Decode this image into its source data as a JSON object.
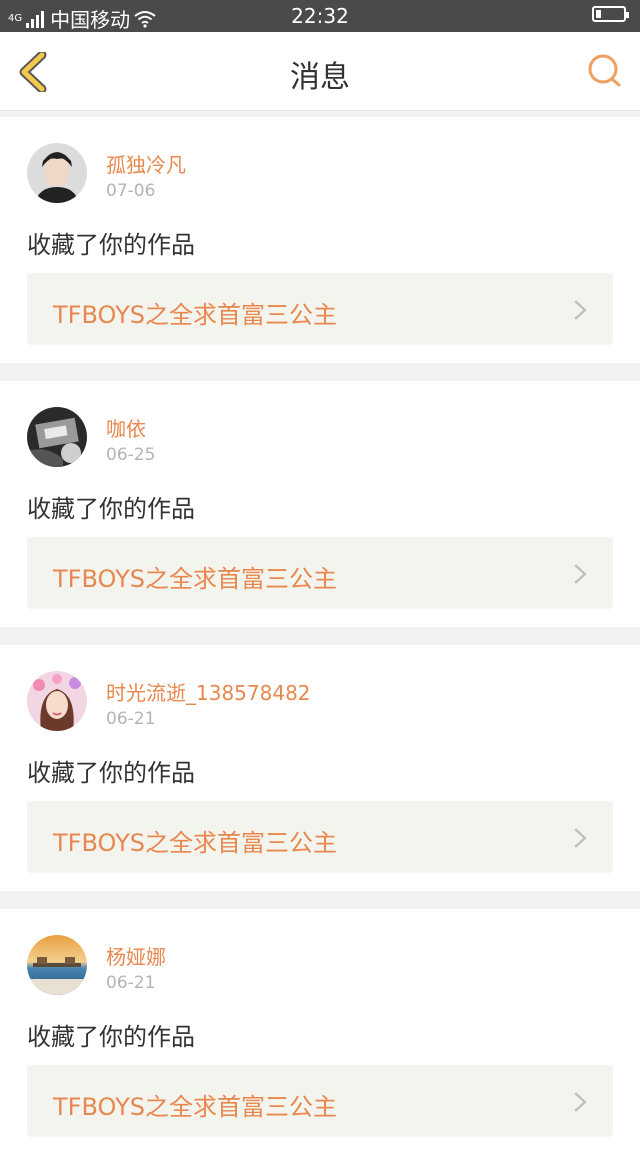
{
  "status_bar": {
    "network": "4G",
    "carrier": "中国移动",
    "time": "22:32"
  },
  "header": {
    "title": "消息",
    "back_icon": "chevron-left-icon",
    "search_icon": "search-icon"
  },
  "colors": {
    "accent": "#e8874e",
    "back_arrow": "#f2c94c",
    "status_bar_bg": "#4a4a4a",
    "work_box_bg": "#f4f4ef"
  },
  "messages": [
    {
      "username": "孤独冷凡",
      "date": "07-06",
      "action": "收藏了你的作品",
      "work_title": "TFBOYS之全求首富三公主"
    },
    {
      "username": "咖依",
      "date": "06-25",
      "action": "收藏了你的作品",
      "work_title": "TFBOYS之全求首富三公主"
    },
    {
      "username": "时光流逝_138578482",
      "date": "06-21",
      "action": "收藏了你的作品",
      "work_title": "TFBOYS之全求首富三公主"
    },
    {
      "username": "杨娅娜",
      "date": "06-21",
      "action": "收藏了你的作品",
      "work_title": "TFBOYS之全求首富三公主"
    }
  ]
}
